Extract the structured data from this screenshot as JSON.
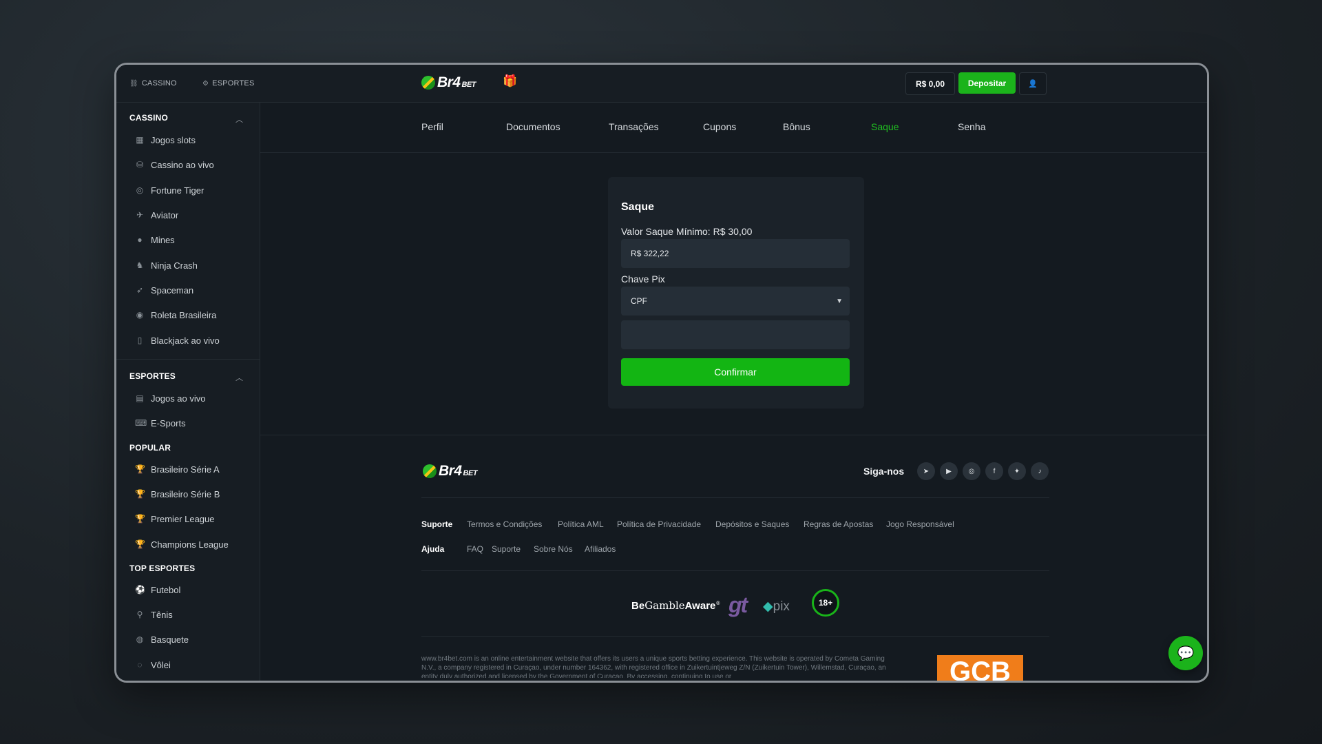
{
  "topbar": {
    "tabs": [
      {
        "label": "CASSINO",
        "icon": "link-icon"
      },
      {
        "label": "ESPORTES",
        "icon": "gear-icon"
      }
    ],
    "logo": {
      "main": "Br4",
      "suffix": "BET"
    },
    "balance": "R$ 0,00",
    "deposit_label": "Depositar"
  },
  "sidebar": {
    "cassino": {
      "title": "CASSINO",
      "items": [
        "Jogos slots",
        "Cassino ao vivo",
        "Fortune Tiger",
        "Aviator",
        "Mines",
        "Ninja Crash",
        "Spaceman",
        "Roleta Brasileira",
        "Blackjack ao vivo"
      ]
    },
    "esportes": {
      "title": "ESPORTES",
      "items": [
        "Jogos ao vivo",
        "E-Sports"
      ]
    },
    "popular": {
      "title": "POPULAR",
      "items": [
        "Brasileiro Série A",
        "Brasileiro Série B",
        "Premier League",
        "Champions League"
      ]
    },
    "top_esportes": {
      "title": "TOP ESPORTES",
      "items": [
        "Futebol",
        "Tênis",
        "Basquete",
        "Vôlei"
      ]
    }
  },
  "tabs": [
    "Perfil",
    "Documentos",
    "Transações",
    "Cupons",
    "Bônus",
    "Saque",
    "Senha"
  ],
  "active_tab": "Saque",
  "saque": {
    "title": "Saque",
    "min_label": "Valor Saque Mínimo: R$ 30,00",
    "amount_value": "R$ 322,22",
    "pix_label": "Chave Pix",
    "pix_type": "CPF",
    "pix_key_value": "",
    "confirm_label": "Confirmar"
  },
  "footer": {
    "follow_label": "Siga-nos",
    "social_icons": [
      "telegram-icon",
      "youtube-icon",
      "instagram-icon",
      "facebook-icon",
      "twitter-icon",
      "tiktok-icon"
    ],
    "support_label": "Suporte",
    "support_links": [
      "Termos e Condições",
      "Política AML",
      "Política de Privacidade",
      "Depósitos e Saques",
      "Regras de Apostas",
      "Jogo Responsável"
    ],
    "help_label": "Ajuda",
    "help_links": [
      "FAQ",
      "Suporte",
      "Sobre Nós",
      "Afiliados"
    ],
    "begamble": {
      "be": "Be",
      "gamble": "Gamble",
      "aware": "Aware"
    },
    "gt_logo": "gt",
    "pix_logo": "pix",
    "age_badge": "18+",
    "legal_text": "www.br4bet.com is an online entertainment website that offers its users a unique sports betting experience. This website is operated by Cometa Gaming N.V., a company registered in Curaçao, under number 164362, with registered office in Zuikertuintjeweg Z/N (Zuikertuin Tower), Willemstad, Curaçao, an entity duly authorized and licensed by the Government of Curaçao. By accessing, continuing to use or",
    "gcb_label": "GCB"
  },
  "colors": {
    "accent": "#1bb31b",
    "active_tab": "#20c020",
    "background": "#141a20",
    "panel": "#1b2229"
  }
}
